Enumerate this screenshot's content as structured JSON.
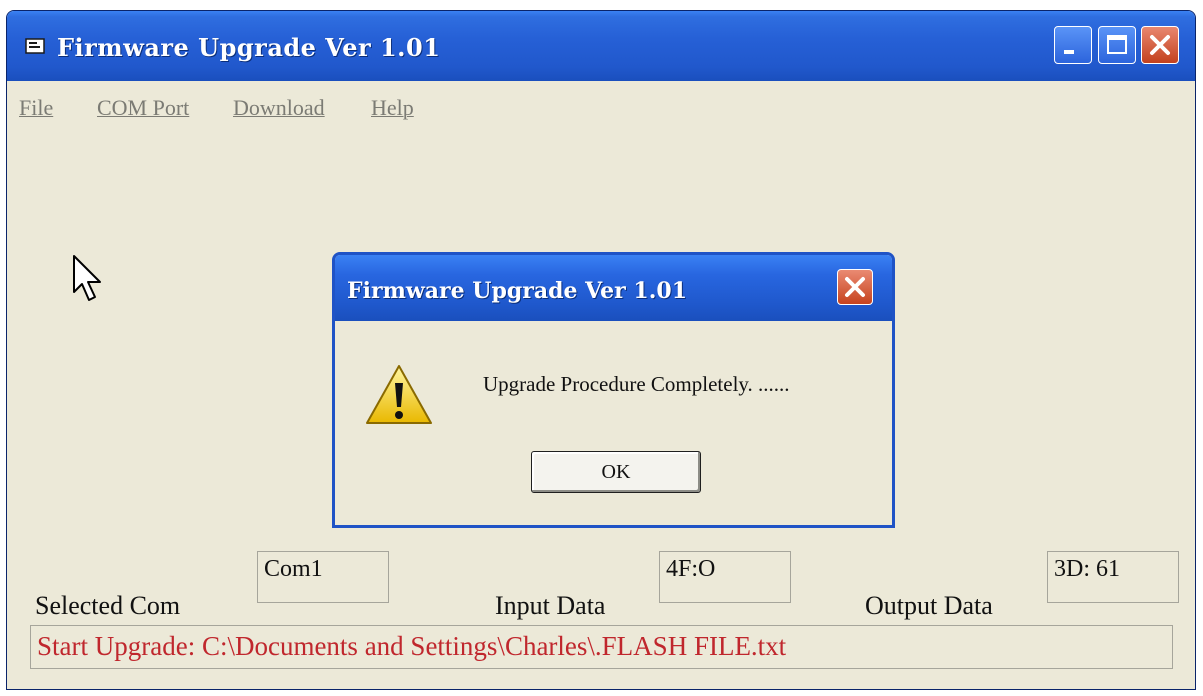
{
  "window": {
    "title": "Firmware Upgrade Ver 1.01",
    "title_color": "#ffffff",
    "titlebar_color": "#2158cc"
  },
  "menu": {
    "items": [
      {
        "label": "File"
      },
      {
        "label": "COM Port"
      },
      {
        "label": "Download"
      },
      {
        "label": "Help"
      }
    ]
  },
  "dialog": {
    "title": "Firmware Upgrade Ver 1.01",
    "message": "Upgrade Procedure Completely. ......",
    "ok_label": "OK",
    "icon": "warning-icon"
  },
  "fields": {
    "selected_com_label": "Selected Com",
    "selected_com_value": "Com1",
    "input_data_label": "Input Data",
    "input_data_value": "4F:O",
    "output_data_label": "Output Data",
    "output_data_value": "3D: 61"
  },
  "status": {
    "text": "Start Upgrade: C:\\Documents and Settings\\Charles\\.FLASH FILE.txt",
    "color": "#c0272d"
  },
  "colors": {
    "face": "#ece9d8",
    "accent_blue": "#2158cc",
    "close_red": "#c6431f"
  }
}
